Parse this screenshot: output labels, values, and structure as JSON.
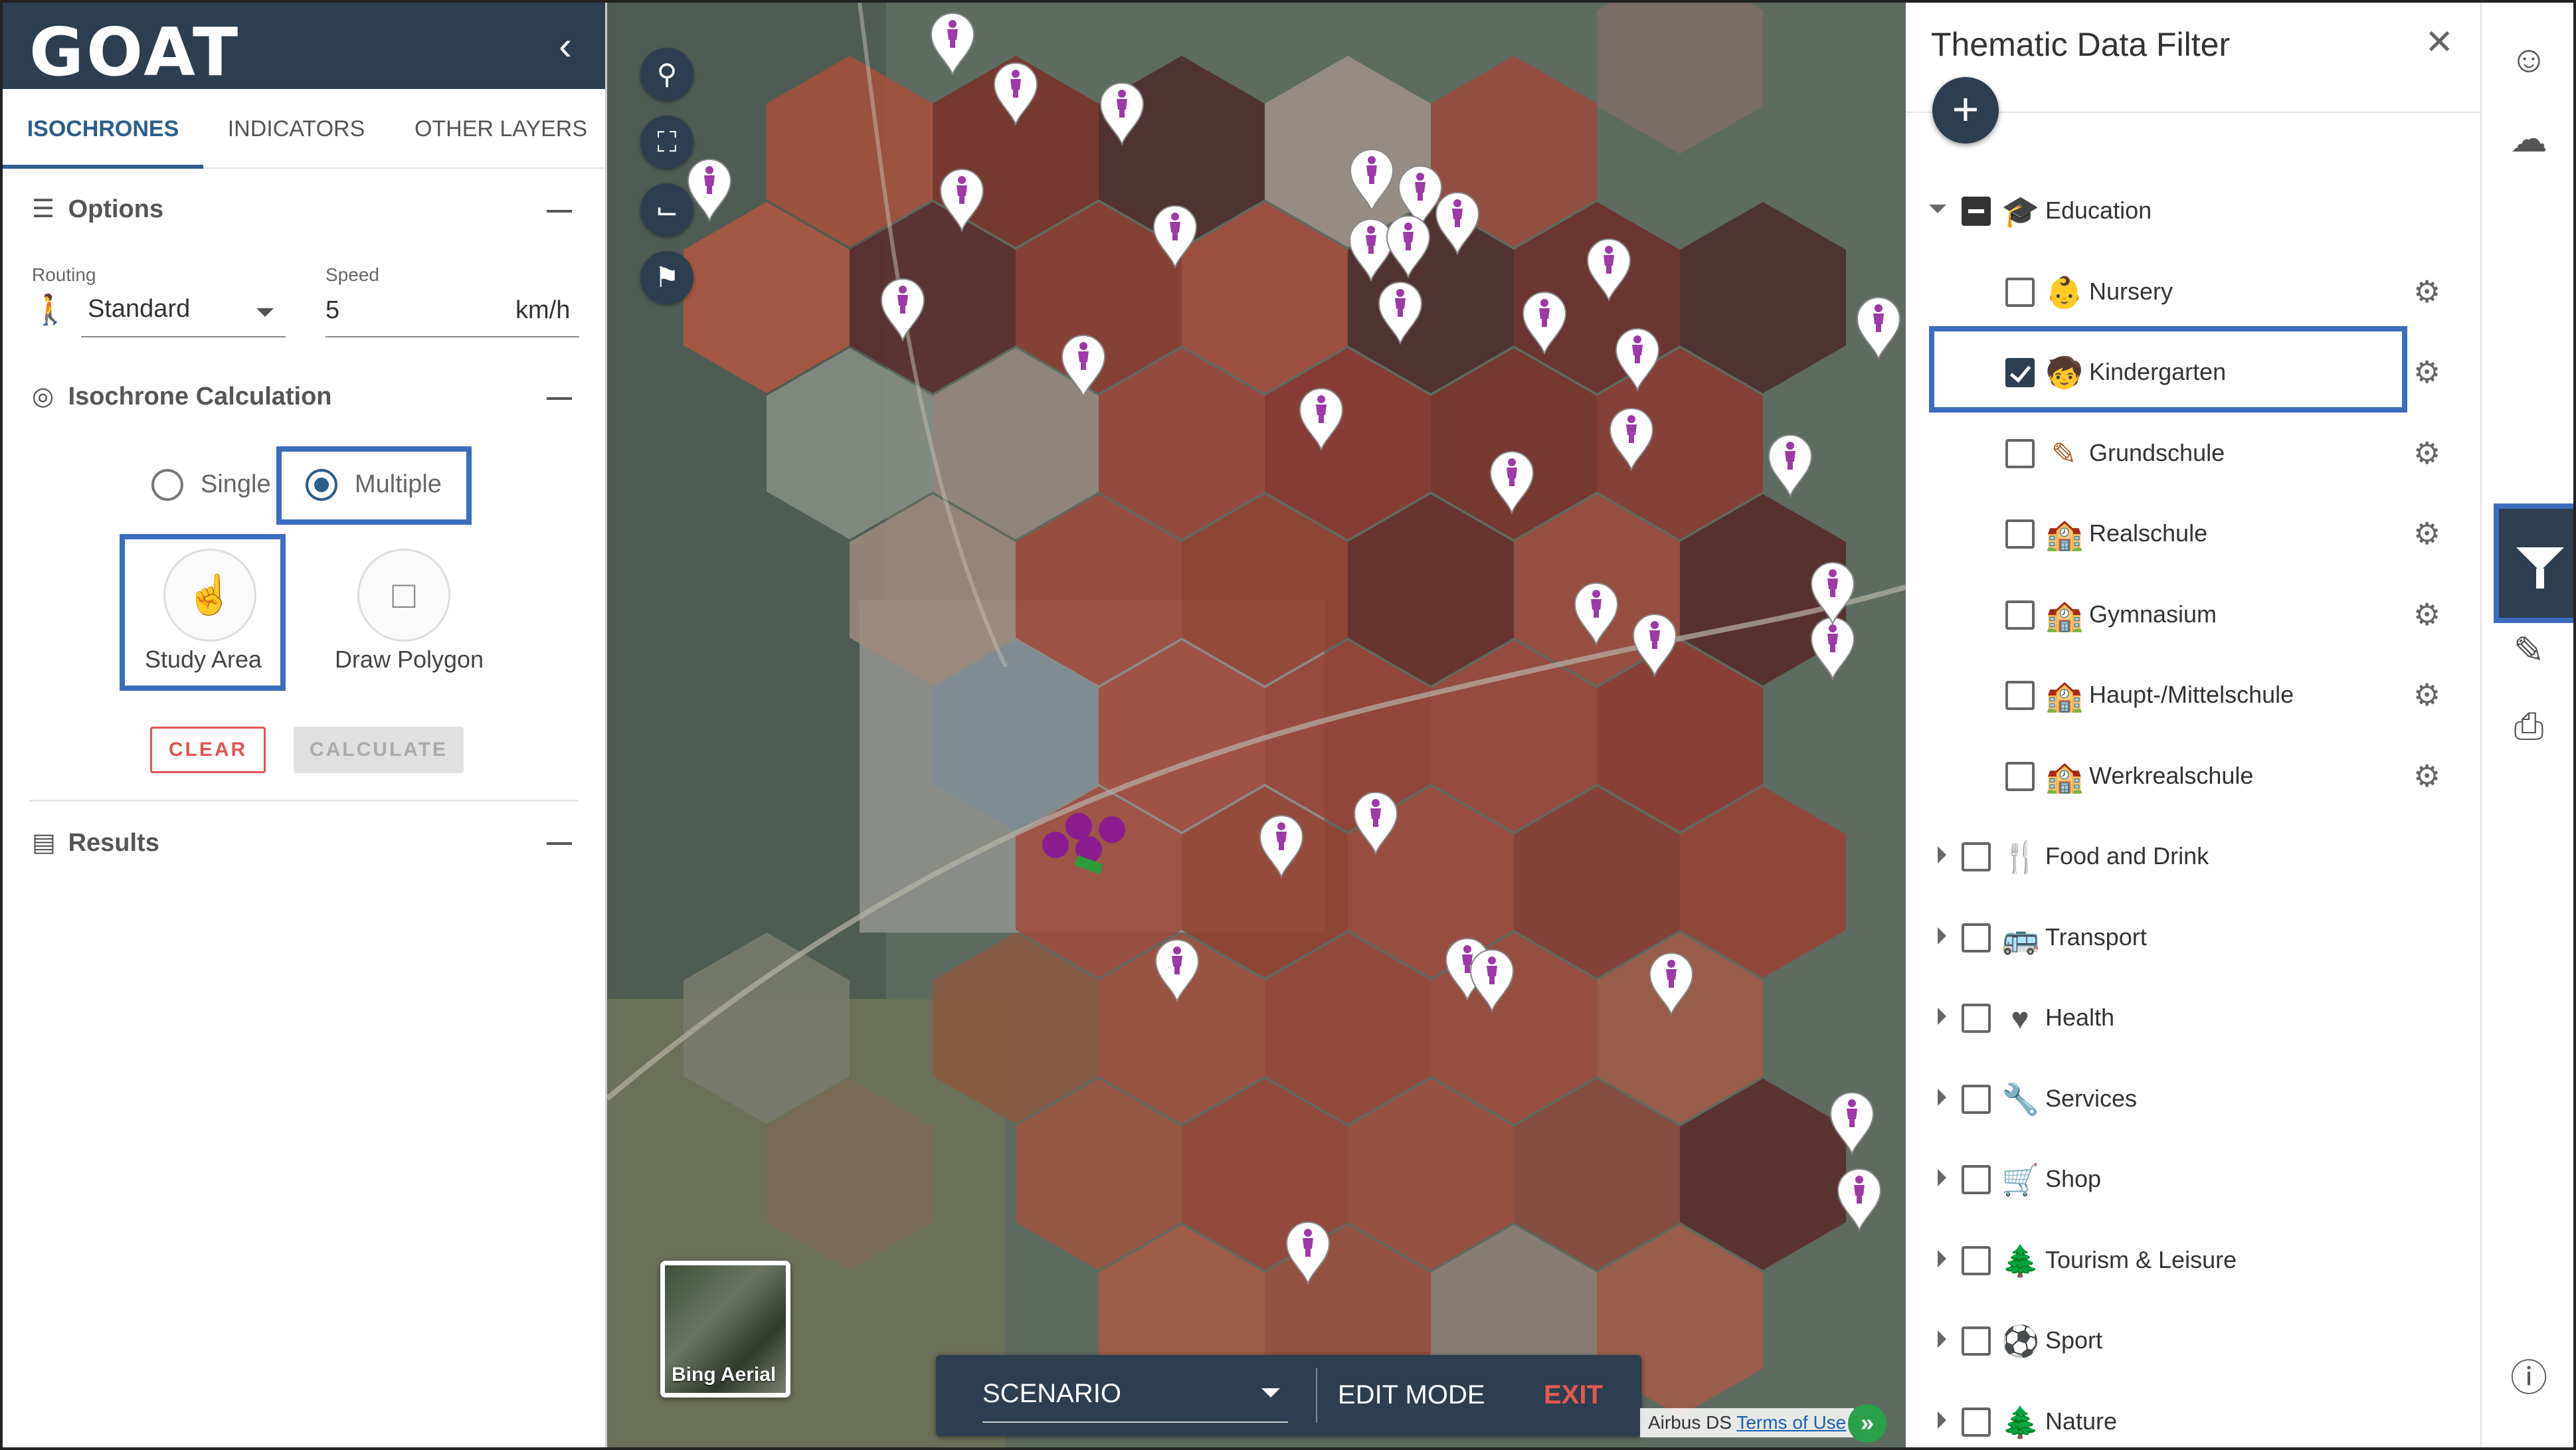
{
  "brand": {
    "logo": "GOAT"
  },
  "left_panel": {
    "tabs": [
      "ISOCHRONES",
      "INDICATORS",
      "OTHER LAYERS"
    ],
    "options": {
      "title": "Options",
      "routing_label": "Routing",
      "routing_value": "Standard",
      "speed_label": "Speed",
      "speed_value": "5",
      "speed_unit": "km/h"
    },
    "isochrone": {
      "title": "Isochrone Calculation",
      "single_label": "Single",
      "multiple_label": "Multiple",
      "selected": "Multiple",
      "study_area_label": "Study Area",
      "draw_polygon_label": "Draw Polygon",
      "clear_label": "CLEAR",
      "calculate_label": "CALCULATE"
    },
    "results": {
      "title": "Results"
    }
  },
  "map": {
    "basemap_label": "Bing Aerial",
    "scenario_label": "SCENARIO",
    "edit_mode_label": "EDIT MODE",
    "exit_label": "EXIT",
    "attribution_text": "Airbus DS",
    "attribution_link": "Terms of Use",
    "pin_color": "#9c3aa6",
    "tools": [
      "search-icon",
      "fullscreen-icon",
      "measure-icon",
      "map-layers-icon"
    ]
  },
  "filter_panel": {
    "title": "Thematic Data Filter",
    "groups": [
      {
        "label": "Education",
        "icon": "graduation-cap-icon",
        "expanded": true,
        "state": "indeterminate",
        "children": [
          {
            "label": "Nursery",
            "icon": "baby-icon",
            "checked": false
          },
          {
            "label": "Kindergarten",
            "icon": "child-icon",
            "checked": true
          },
          {
            "label": "Grundschule",
            "icon": "pencil-icon",
            "checked": false
          },
          {
            "label": "Realschule",
            "icon": "school-icon",
            "checked": false
          },
          {
            "label": "Gymnasium",
            "icon": "school-icon",
            "checked": false
          },
          {
            "label": "Haupt-/Mittelschule",
            "icon": "school-icon",
            "checked": false
          },
          {
            "label": "Werkrealschule",
            "icon": "school-icon",
            "checked": false
          }
        ]
      },
      {
        "label": "Food and Drink",
        "icon": "utensils-icon",
        "expanded": false,
        "state": "unchecked"
      },
      {
        "label": "Transport",
        "icon": "bus-icon",
        "expanded": false,
        "state": "unchecked"
      },
      {
        "label": "Health",
        "icon": "heart-icon",
        "expanded": false,
        "state": "unchecked"
      },
      {
        "label": "Services",
        "icon": "wrench-icon",
        "expanded": false,
        "state": "unchecked"
      },
      {
        "label": "Shop",
        "icon": "cart-icon",
        "expanded": false,
        "state": "unchecked"
      },
      {
        "label": "Tourism & Leisure",
        "icon": "tree-icon",
        "expanded": false,
        "state": "unchecked"
      },
      {
        "label": "Sport",
        "icon": "ball-icon",
        "expanded": false,
        "state": "unchecked"
      },
      {
        "label": "Nature",
        "icon": "tree-icon",
        "expanded": false,
        "state": "unchecked"
      }
    ]
  },
  "colors": {
    "primary": "#2c3e50",
    "accent_highlight": "#3b6cbe",
    "clear_red": "#e05555",
    "exit_red": "#e35a4f"
  }
}
